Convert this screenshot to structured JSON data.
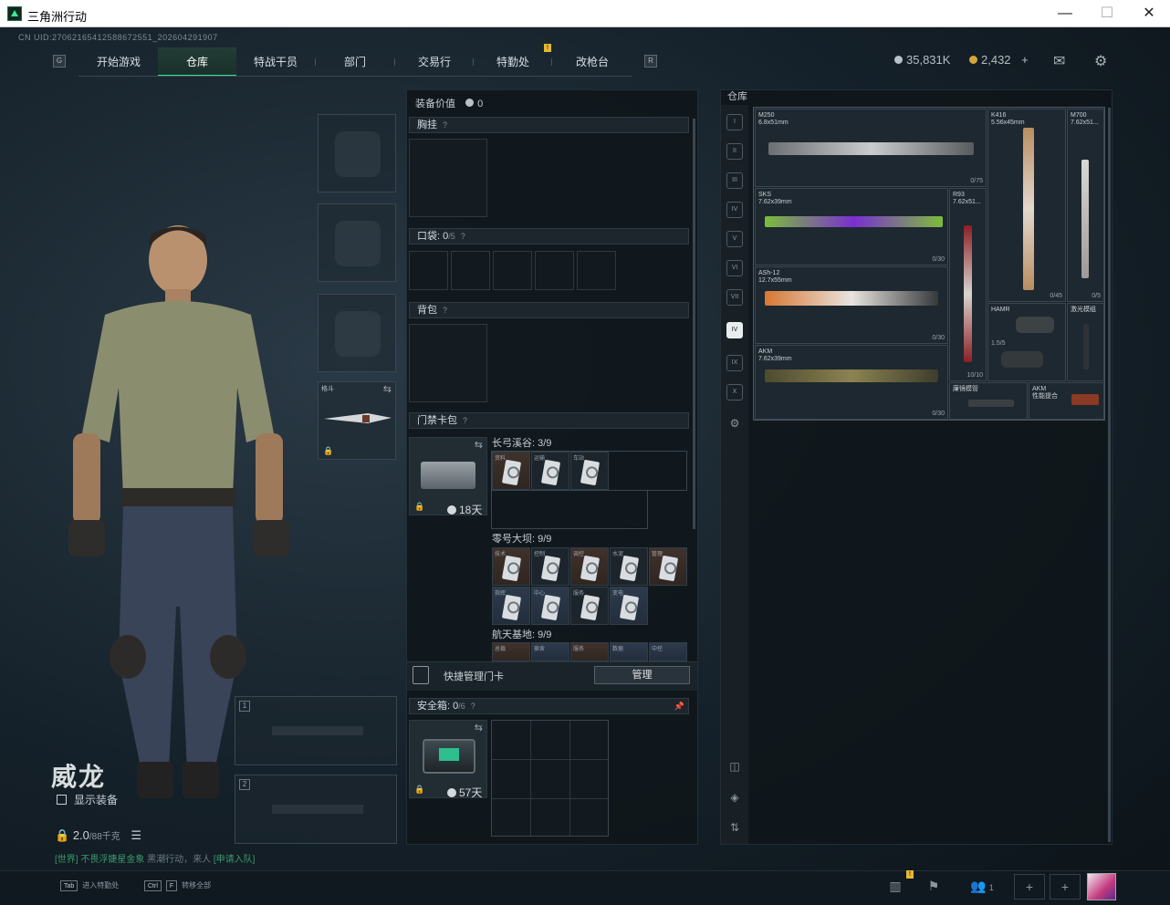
{
  "window": {
    "title": "三角洲行动",
    "min": "—",
    "max": "☐",
    "close": "✕"
  },
  "uid": "CN UID:2706216541258867255­1_202604291907",
  "nav": {
    "left_badge": "G",
    "right_badge": "R",
    "alert_badge": "!",
    "tabs": [
      {
        "label": "开始游戏"
      },
      {
        "label": "仓库"
      },
      {
        "label": "特战干员"
      },
      {
        "label": "部门"
      },
      {
        "label": "交易行"
      },
      {
        "label": "特勤处"
      },
      {
        "label": "改枪台"
      }
    ]
  },
  "currency": {
    "silver": "35,831K",
    "gold": "2,432",
    "plus": "+"
  },
  "character": {
    "name": "威龙",
    "show_equip": "显示装备",
    "weight_value": "2.0",
    "weight_max": "/88千克",
    "chat_prefix": "[世界] 不畏浮婕星金象",
    "chat_mid": "黑潮行动，来人",
    "chat_link": "[申请入队]"
  },
  "gear": {
    "melee_label": "格斗",
    "swap": "⇆",
    "weapon1_num": "1",
    "weapon2_num": "2"
  },
  "loadout": {
    "header_label": "装备价值",
    "header_value": "0",
    "chest_rig": "胸挂",
    "help": "?",
    "pocket_label": "口袋:",
    "pocket_value": "0",
    "pocket_max": "/5",
    "backpack": "背包",
    "keycard_bag": "门禁卡包",
    "keycard_days": "18天",
    "maps": [
      {
        "title": "长弓溪谷: 3/9",
        "cells": [
          "资料",
          "运输",
          "车站"
        ]
      },
      {
        "title": "零号大坝: 9/9",
        "cells": [
          "技术",
          "控制",
          "调控",
          "水泥",
          "管理",
          "指挥",
          "中心",
          "服务",
          "变电"
        ]
      },
      {
        "title": "航天基地: 9/9",
        "cells": [
          "总裁",
          "宿舍",
          "服务",
          "数据",
          "中控"
        ]
      }
    ],
    "quick_manage": "快捷管理门卡",
    "manage_btn": "管理",
    "safe_label": "安全箱:",
    "safe_value": "0",
    "safe_max": "/6",
    "safe_days": "57天",
    "pin": "📌"
  },
  "warehouse": {
    "title": "仓库",
    "side_icons": [
      "I",
      "II",
      "III",
      "IV",
      "V",
      "VI",
      "VII",
      "IV",
      "IX",
      "X",
      "⚙"
    ],
    "items": [
      {
        "name": "M250\n6.8x51mm",
        "ammo": "0/75"
      },
      {
        "name": "K416\n5.56x45mm",
        "ammo": "0/45"
      },
      {
        "name": "M700\n7.62x51...",
        "ammo": "0/5"
      },
      {
        "name": "SKS\n7.62x39mm",
        "ammo": "0/30"
      },
      {
        "name": "R93\n7.62x51...",
        "ammo": "10/10"
      },
      {
        "name": "ASh-12\n12.7x55mm",
        "ammo": "0/30"
      },
      {
        "name": "HAMR",
        "ammo": "1.5/5"
      },
      {
        "name": "激光模组",
        "ammo": ""
      },
      {
        "name": "AKM\n7.62x39mm",
        "ammo": "0/30"
      },
      {
        "name": "廉镜模管",
        "ammo": ""
      },
      {
        "name": "AKM\n性能提合",
        "ammo": ""
      }
    ]
  },
  "bottom": {
    "tab_key": "Tab",
    "tab_label": "进入特勤处",
    "ctrl_key": "Ctrl",
    "f_key": "F",
    "f_label": "转移全部",
    "friend_count": "1"
  }
}
